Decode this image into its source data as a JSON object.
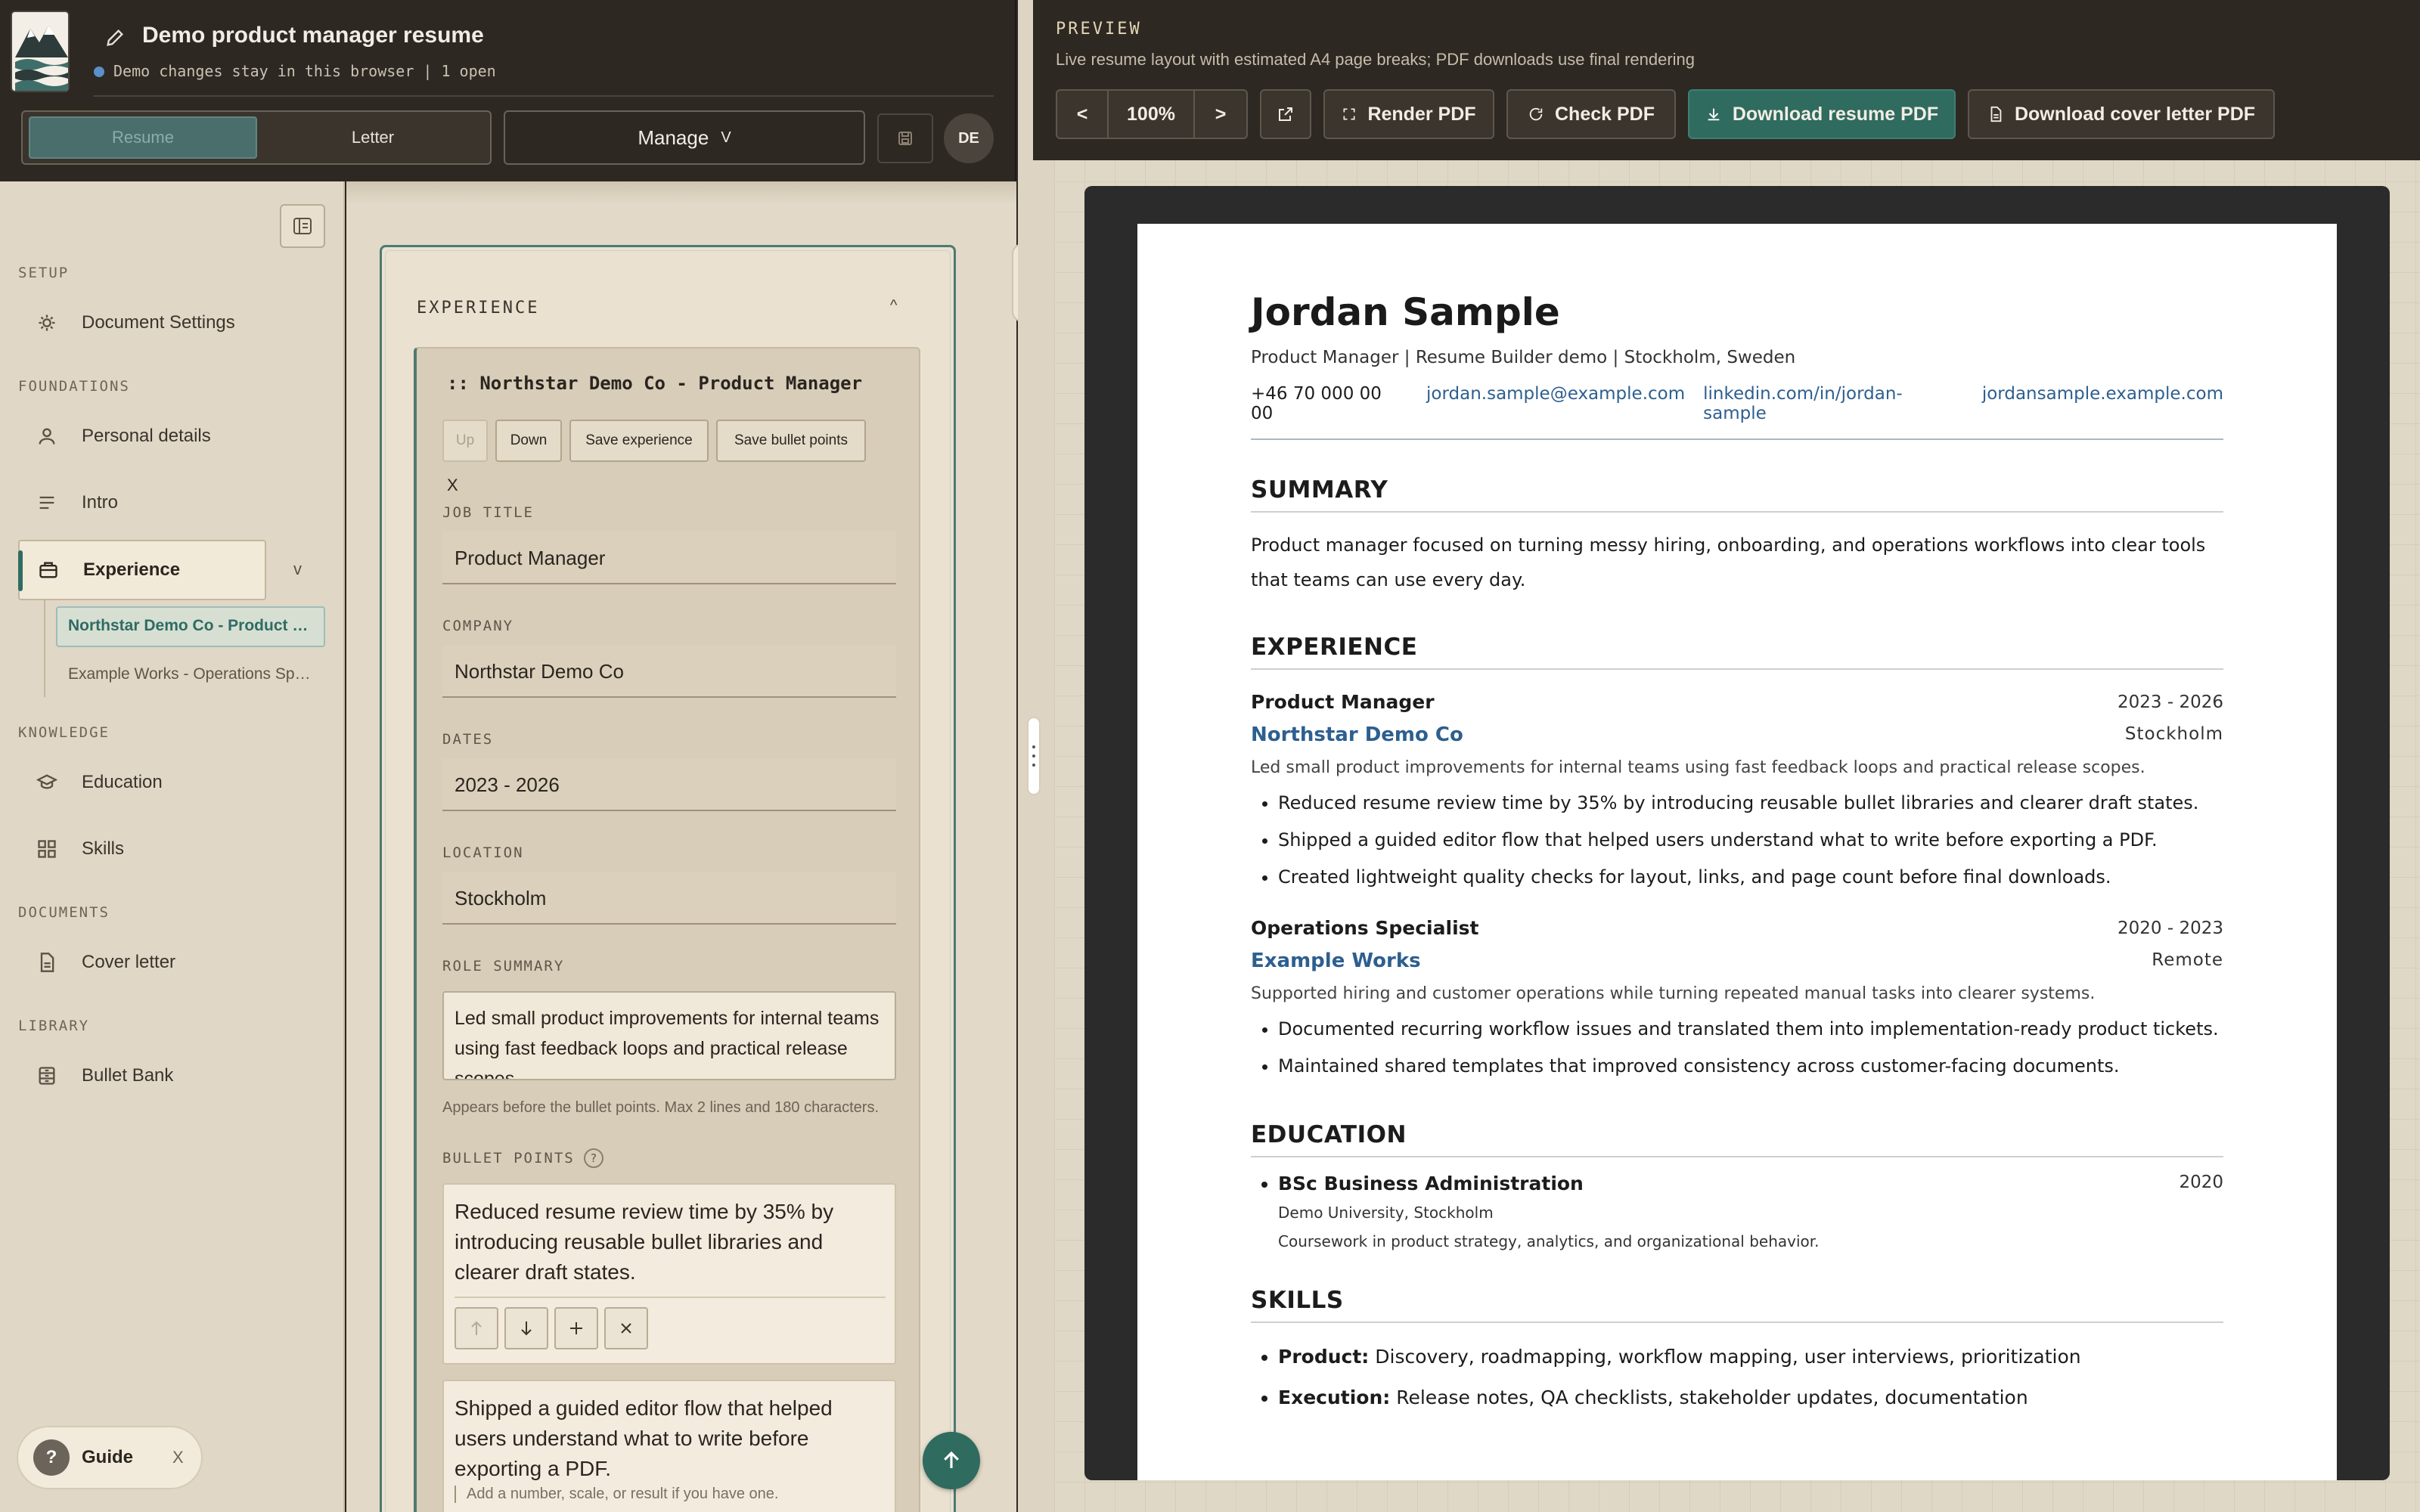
{
  "header": {
    "title": "Demo product manager resume",
    "status": "Demo changes stay in this browser | 1 open",
    "tabs": {
      "resume": "Resume",
      "letter": "Letter"
    },
    "manage_label": "Manage",
    "manage_chevron": "V",
    "language": "DE"
  },
  "sidebar": {
    "sections": {
      "setup": "SETUP",
      "foundations": "FOUNDATIONS",
      "knowledge": "KNOWLEDGE",
      "documents": "DOCUMENTS",
      "library": "LIBRARY"
    },
    "items": {
      "document_settings": "Document Settings",
      "personal_details": "Personal details",
      "intro": "Intro",
      "experience": "Experience",
      "education": "Education",
      "skills": "Skills",
      "cover_letter": "Cover letter",
      "bullet_bank": "Bullet Bank"
    },
    "experience_chevron": "v",
    "sub_items": [
      "Northstar Demo Co - Product Manager",
      "Example Works - Operations Specialist"
    ],
    "guide": {
      "label": "Guide",
      "close": "X",
      "icon": "?"
    }
  },
  "editor": {
    "section_title": "EXPERIENCE",
    "collapse": "^",
    "entry_title": ":: Northstar Demo Co - Product Manager",
    "buttons": {
      "up": "Up",
      "down": "Down",
      "save_experience": "Save experience",
      "save_bullets": "Save bullet points"
    },
    "remove": "X",
    "fields": {
      "job_title_label": "JOB TITLE",
      "job_title": "Product Manager",
      "company_label": "COMPANY",
      "company": "Northstar Demo Co",
      "dates_label": "DATES",
      "dates": "2023 - 2026",
      "location_label": "LOCATION",
      "location": "Stockholm",
      "role_summary_label": "ROLE SUMMARY",
      "role_summary": "Led small product improvements for internal teams using fast feedback loops and practical release scopes.",
      "role_summary_hint": "Appears before the bullet points. Max 2 lines and 180 characters.",
      "bullets_label": "BULLET POINTS",
      "bullets_help": "?"
    },
    "bullets": [
      "Reduced resume review time by 35% by introducing reusable bullet libraries and clearer draft states.",
      "Shipped a guided editor flow that helped users understand what to write before exporting a PDF."
    ],
    "bullet_hint": "Add a number, scale, or result if you have one."
  },
  "preview": {
    "label": "PREVIEW",
    "description": "Live resume layout with estimated A4 page breaks; PDF downloads use final rendering",
    "zoom": "100%",
    "prev": "<",
    "next": ">",
    "render_pdf": "Render PDF",
    "check_pdf": "Check PDF",
    "download_resume": "Download resume PDF",
    "download_letter": "Download cover letter PDF"
  },
  "resume": {
    "name": "Jordan Sample",
    "tagline": "Product Manager | Resume Builder demo | Stockholm, Sweden",
    "contacts": {
      "phone": "+46 70 000 00 00",
      "email": "jordan.sample@example.com",
      "linkedin": "linkedin.com/in/jordan-sample",
      "website": "jordansample.example.com"
    },
    "summary_heading": "SUMMARY",
    "summary": "Product manager focused on turning messy hiring, onboarding, and operations workflows into clear tools that teams can use every day.",
    "experience_heading": "EXPERIENCE",
    "jobs": [
      {
        "role": "Product Manager",
        "dates": "2023 - 2026",
        "company": "Northstar Demo Co",
        "location": "Stockholm",
        "summary": "Led small product improvements for internal teams using fast feedback loops and practical release scopes.",
        "bullets": [
          "Reduced resume review time by 35% by introducing reusable bullet libraries and clearer draft states.",
          "Shipped a guided editor flow that helped users understand what to write before exporting a PDF.",
          "Created lightweight quality checks for layout, links, and page count before final downloads."
        ]
      },
      {
        "role": "Operations Specialist",
        "dates": "2020 - 2023",
        "company": "Example Works",
        "location": "Remote",
        "summary": "Supported hiring and customer operations while turning repeated manual tasks into clearer systems.",
        "bullets": [
          "Documented recurring workflow issues and translated them into implementation-ready product tickets.",
          "Maintained shared templates that improved consistency across customer-facing documents."
        ]
      }
    ],
    "education_heading": "EDUCATION",
    "education": {
      "degree": "BSc Business Administration",
      "year": "2020",
      "school": "Demo University, Stockholm",
      "coursework": "Coursework in product strategy, analytics, and organizational behavior."
    },
    "skills_heading": "SKILLS",
    "skills": [
      {
        "label": "Product:",
        "value": "Discovery, roadmapping, workflow mapping, user interviews, prioritization"
      },
      {
        "label": "Execution:",
        "value": "Release notes, QA checklists, stakeholder updates, documentation"
      }
    ]
  }
}
